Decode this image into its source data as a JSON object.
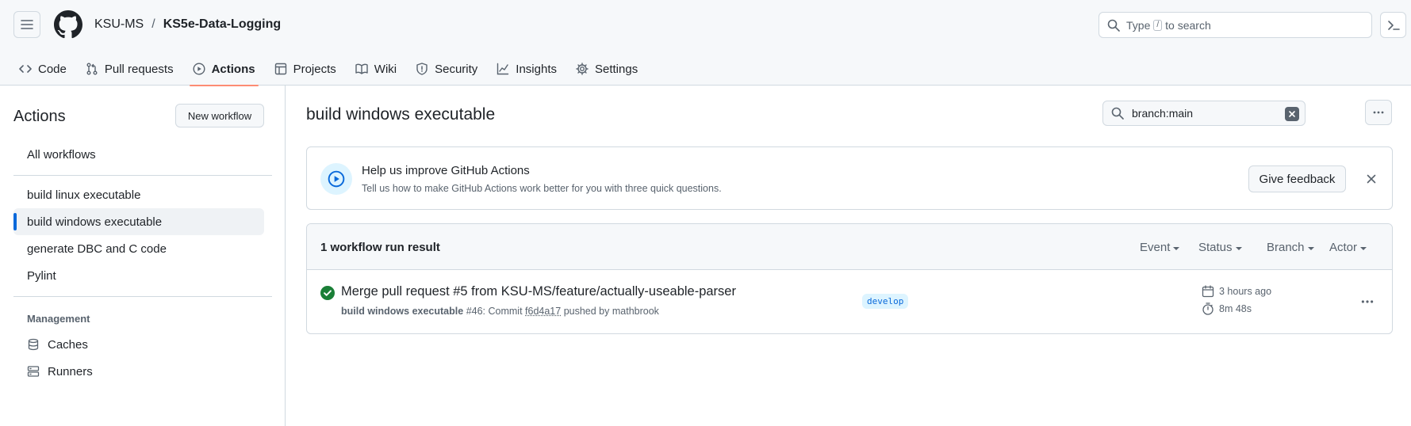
{
  "header": {
    "owner": "KSU-MS",
    "separator": "/",
    "repo": "KS5e-Data-Logging",
    "search_prefix": "Type",
    "search_key": "/",
    "search_suffix": "to search"
  },
  "tabs": [
    {
      "label": "Code",
      "icon": "code-icon",
      "active": false
    },
    {
      "label": "Pull requests",
      "icon": "pull-request-icon",
      "active": false
    },
    {
      "label": "Actions",
      "icon": "play-icon",
      "active": true
    },
    {
      "label": "Projects",
      "icon": "table-icon",
      "active": false
    },
    {
      "label": "Wiki",
      "icon": "book-icon",
      "active": false
    },
    {
      "label": "Security",
      "icon": "shield-icon",
      "active": false
    },
    {
      "label": "Insights",
      "icon": "graph-icon",
      "active": false
    },
    {
      "label": "Settings",
      "icon": "gear-icon",
      "active": false
    }
  ],
  "sidebar": {
    "title": "Actions",
    "new_workflow": "New workflow",
    "all_workflows": "All workflows",
    "workflows": [
      {
        "label": "build linux executable",
        "selected": false
      },
      {
        "label": "build windows executable",
        "selected": true
      },
      {
        "label": "generate DBC and C code",
        "selected": false
      },
      {
        "label": "Pylint",
        "selected": false
      }
    ],
    "management_heading": "Management",
    "management": [
      {
        "label": "Caches",
        "icon": "database-icon"
      },
      {
        "label": "Runners",
        "icon": "server-icon"
      }
    ]
  },
  "main": {
    "title": "build windows executable",
    "filter_value": "branch:main"
  },
  "feedback": {
    "title": "Help us improve GitHub Actions",
    "subtitle": "Tell us how to make GitHub Actions work better for you with three quick questions.",
    "button": "Give feedback"
  },
  "runs": {
    "count_label": "1 workflow run result",
    "filters": [
      "Event",
      "Status",
      "Branch",
      "Actor"
    ],
    "items": [
      {
        "status": "success",
        "title": "Merge pull request #5 from KSU-MS/feature/actually-useable-parser",
        "workflow": "build windows executable",
        "run_number": "#46: Commit",
        "commit": "f6d4a17",
        "pushed_by": "pushed by mathbrook",
        "branch": "develop",
        "time_ago": "3 hours ago",
        "duration": "8m 48s"
      }
    ]
  },
  "colors": {
    "accent": "#0969da",
    "active_tab_underline": "#fd8c73",
    "success": "#1a7f37",
    "branch_bg": "#ddf4ff"
  }
}
